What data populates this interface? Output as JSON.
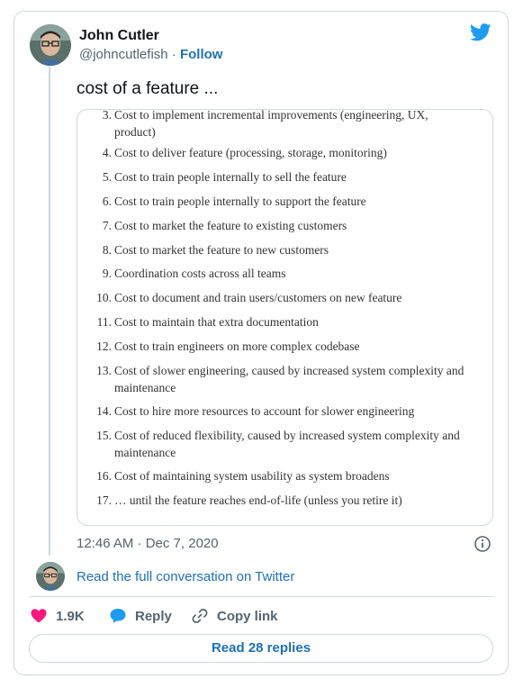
{
  "author": {
    "name": "John Cutler",
    "handle": "@johncutlefish",
    "separator": "·",
    "follow_label": "Follow"
  },
  "tweet": {
    "text": "cost of a feature ...",
    "timestamp": "12:46 AM · Dec 7, 2020"
  },
  "media_list": [
    {
      "num": "3.",
      "text": "Cost to implement incremental improvements (engineering, UX, product)"
    },
    {
      "num": "4.",
      "text": "Cost to deliver feature (processing, storage, monitoring)"
    },
    {
      "num": "5.",
      "text": "Cost to train people internally to sell the feature"
    },
    {
      "num": "6.",
      "text": "Cost to train people internally to support the feature"
    },
    {
      "num": "7.",
      "text": "Cost to market the feature to existing customers"
    },
    {
      "num": "8.",
      "text": "Cost to market the feature to new customers"
    },
    {
      "num": "9.",
      "text": "Coordination costs across all teams"
    },
    {
      "num": "10.",
      "text": "Cost to document and train users/customers on new feature"
    },
    {
      "num": "11.",
      "text": "Cost to maintain that extra documentation"
    },
    {
      "num": "12.",
      "text": "Cost to train engineers on more complex codebase"
    },
    {
      "num": "13.",
      "text": "Cost of slower engineering, caused by increased system complexity and maintenance"
    },
    {
      "num": "14.",
      "text": "Cost to hire more resources to account for slower engineering"
    },
    {
      "num": "15.",
      "text": "Cost of reduced flexibility, caused by increased system complexity and maintenance"
    },
    {
      "num": "16.",
      "text": "Cost of maintaining system usability as system broadens"
    },
    {
      "num": "17.",
      "text": "… until the feature reaches end-of-life (unless you retire it)"
    }
  ],
  "conversation": {
    "link_label": "Read the full conversation on Twitter"
  },
  "actions": {
    "like_count": "1.9K",
    "reply_label": "Reply",
    "copy_link_label": "Copy link"
  },
  "read_replies_label": "Read 28 replies",
  "colors": {
    "accent": "#1d70b8",
    "twitter_blue": "#1d9bf0",
    "heart": "#f91880",
    "muted": "#536471",
    "border": "#cfd9de"
  },
  "icons": {
    "brand": "twitter-bird-icon",
    "info": "info-icon",
    "like": "heart-icon",
    "reply": "speech-bubble-icon",
    "copy": "link-icon"
  }
}
